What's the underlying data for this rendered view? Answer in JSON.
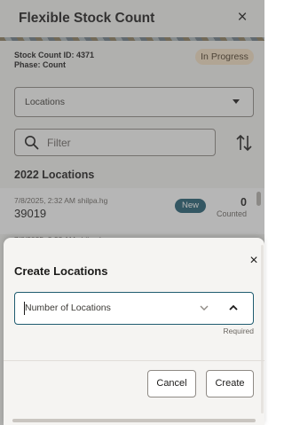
{
  "header": {
    "title": "Flexible Stock Count",
    "close_icon": "×"
  },
  "info": {
    "stock_count_id": "Stock Count ID: 4371",
    "phase": "Phase: Count",
    "status": "In Progress",
    "status_color": "#f6e2c5"
  },
  "locations_select": {
    "label": "Locations"
  },
  "filter": {
    "placeholder": "Filter"
  },
  "section": {
    "title": "2022 Locations"
  },
  "rows": [
    {
      "meta": "7/8/2025, 2:32 AM shilpa.hg",
      "id": "39019",
      "badge": "New",
      "count": "0",
      "count_label": "Counted"
    }
  ],
  "row_peek": "7/8/2025, 2:32 AM shilpa.hg",
  "modal": {
    "title": "Create Locations",
    "close_icon": "×",
    "field": {
      "label": "Number of Locations",
      "required": "Required"
    },
    "cancel_label": "Cancel",
    "create_label": "Create"
  },
  "colors": {
    "accent": "#1f5c70",
    "background": "#f5f4f2",
    "text": "#1c1b1a"
  }
}
